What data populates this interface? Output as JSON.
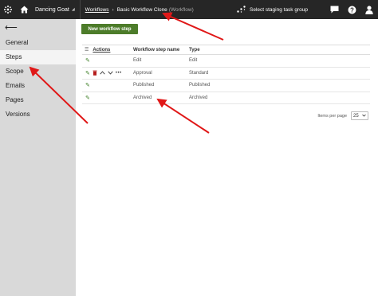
{
  "topbar": {
    "site_name": "Dancing Goat",
    "breadcrumb_link": "Workflows",
    "breadcrumb_current": "Basic Workflow Clone",
    "breadcrumb_sub": "(Workflow)",
    "staging_label": "Select staging task group"
  },
  "sidebar": {
    "items": [
      {
        "label": "General"
      },
      {
        "label": "Steps"
      },
      {
        "label": "Scope"
      },
      {
        "label": "Emails"
      },
      {
        "label": "Pages"
      },
      {
        "label": "Versions"
      }
    ]
  },
  "main": {
    "new_button_label": "New workflow step",
    "columns": {
      "actions": "Actions",
      "name": "Workflow step name",
      "type": "Type"
    },
    "rows": [
      {
        "name": "Edit",
        "type": "Edit"
      },
      {
        "name": "Approval",
        "type": "Standard"
      },
      {
        "name": "Published",
        "type": "Published"
      },
      {
        "name": "Archived",
        "type": "Archived"
      }
    ],
    "pager": {
      "label": "Items per page",
      "value": "25"
    }
  },
  "colors": {
    "topbar": "#262626",
    "sidebar": "#d9d9d9",
    "primary_button": "#4d7c2a",
    "edit_icon": "#3a7d22",
    "delete_icon": "#b51d1d",
    "annotation_arrow": "#e01818"
  },
  "icons": [
    "menu-icon",
    "home-icon",
    "staging-icon",
    "chat-icon",
    "help-icon",
    "user-icon",
    "back-arrow-icon",
    "edit-icon",
    "delete-icon",
    "move-up-icon",
    "move-down-icon",
    "more-icon"
  ]
}
